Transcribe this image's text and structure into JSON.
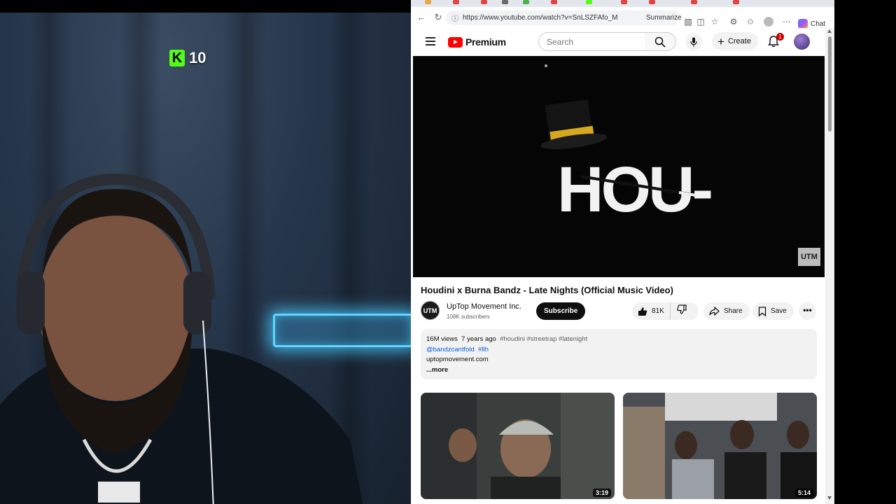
{
  "stream_overlay": {
    "kick_logo_letter": "K",
    "viewer_count": "10"
  },
  "browser": {
    "url": "https://www.youtube.com/watch?v=SnLSZFAfo_M",
    "summarize_label": "Summarize",
    "chat_label": "Chat"
  },
  "youtube": {
    "logo_text": "Premium",
    "search_placeholder": "Search",
    "create_label": "Create",
    "notification_count": "1",
    "video_watermark": "UTM",
    "video_title_card": "HOU-",
    "video_title": "Houdini x Burna Bandz - Late Nights (Official Music Video)",
    "channel": {
      "avatar_text": "UTM",
      "name": "UpTop Movement Inc.",
      "subscribers": "108K subscribers"
    },
    "subscribe_label": "Subscribe",
    "likes": "81K",
    "share_label": "Share",
    "save_label": "Save",
    "more_actions": "•••",
    "description": {
      "views": "16M views",
      "age": "7 years ago",
      "hashtags": "#houdini #streetrap #latenight",
      "mentions": "@bandzcantfold",
      "mention_tag": "#llh",
      "website": "uptopmovement.com",
      "more": "...more"
    },
    "related": [
      {
        "duration": "3:19"
      },
      {
        "duration": "5:14"
      }
    ]
  },
  "colors": {
    "youtube_red": "#ff0000",
    "kick_green": "#53fc18",
    "neon_sign": "#5fd5ff"
  }
}
